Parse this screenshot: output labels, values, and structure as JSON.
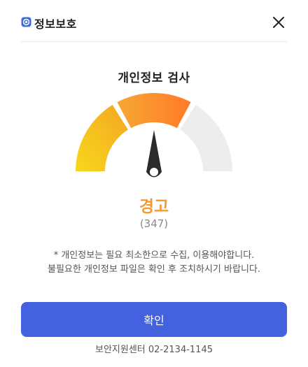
{
  "header": {
    "title": "정보보호",
    "brand_icon": "shield-icon",
    "close_icon": "close-icon"
  },
  "scan": {
    "title": "개인정보 검사",
    "status": "경고",
    "count": "(347)"
  },
  "gauge": {
    "segments": [
      "safe",
      "warning",
      "danger"
    ],
    "level": 0.5,
    "active_segment": "warning",
    "colors": {
      "safe_start": "#f6d81a",
      "safe_end": "#f5a623",
      "warn_start": "#f7a833",
      "warn_end": "#ff7a28",
      "inactive": "#ededed",
      "needle": "#2b2b2b"
    }
  },
  "notice": {
    "line1": "* 개인정보는 필요 최소한으로 수집, 이용해야합니다.",
    "line2": "불필요한 개인정보 파일은 확인 후 조치하시기 바랍니다."
  },
  "actions": {
    "confirm_label": "확인"
  },
  "footer": {
    "contact": "보안지원센터 02-2134-1145"
  },
  "colors": {
    "accent": "#4461e0",
    "status": "#f59a30",
    "brand": "#3a6fd8"
  }
}
